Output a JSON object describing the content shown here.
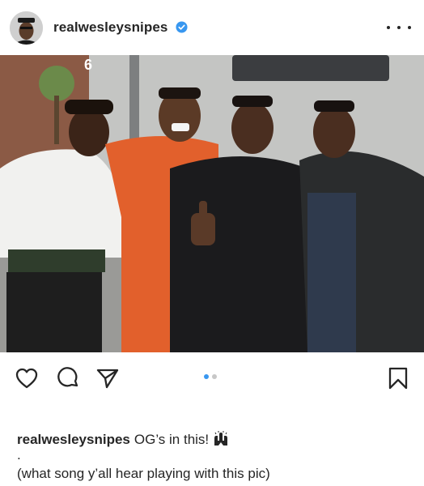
{
  "post": {
    "username": "realwesleysnipes",
    "verified": true,
    "menu_icon": "more-horizontal-icon",
    "avatar_icon": "profile-avatar",
    "photo_alt": "Photo",
    "carousel": {
      "count": 2,
      "active_index": 0
    },
    "actions": [
      "heart-icon",
      "comment-icon",
      "share-icon",
      "bookmark-icon"
    ],
    "caption": {
      "username": "realwesleysnipes",
      "text": "OG’s in this!",
      "emoji": "raised-hands-emoji",
      "separator": ".",
      "line2": "(what song y’all hear playing with this pic)"
    }
  },
  "colors": {
    "text": "#262626",
    "verified_blue": "#3897f0",
    "carousel_active": "#3897f0",
    "carousel_inactive": "#c7c7c7"
  }
}
